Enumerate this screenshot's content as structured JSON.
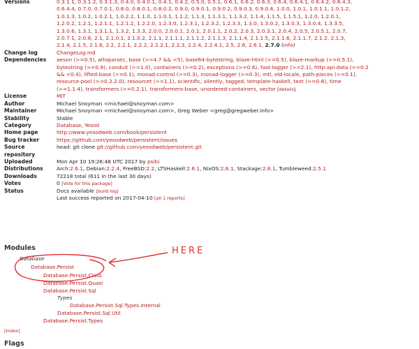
{
  "properties": {
    "versions_label": "Versions",
    "versions_lines": [
      "0.3.1.1, 0.3.1.2, 0.3.1.3, 0.4.0, 0.4.0.1, 0.4.1, 0.4.2, 0.5.0, 0.5.1, 0.6.1, 0.6.2, 0.6.3, 0.6.4, 0.6.4.1, 0.6.4.2, 0.6.4.3,",
      "0.6.4.4, 0.7.0, 0.7.0.1, 0.8.0, 0.8.0.1, 0.8.0.2, 0.9.0, 0.9.0.1, 0.9.0.2, 0.9.0.3, 0.9.0.4, 1.0.0, 1.0.1, 1.0.1.1, 1.0.1.2,",
      "1.0.1.3, 1.0.2, 1.0.2.1, 1.0.2.2, 1.1.0, 1.1.0.1, 1.1.2, 1.1.3, 1.1.3.1, 1.1.3.2, 1.1.4, 1.1.5, 1.1.5.1, 1.2.0, 1.2.0.1,",
      "1.2.0.2, 1.2.1, 1.2.1.1, 1.2.1.2, 1.2.2.0, 1.2.3.0, 1.2.3.1, 1.2.3.2, 1.2.3.3, 1.3.0, 1.3.0.2, 1.3.0.3, 1.3.0.4, 1.3.3.5,",
      "1.3.0.6, 1.3.1, 1.3.1.1, 1.3.2, 1.3.3, 2.0.0, 2.0.0.1, 2.0.1, 2.0.1.1, 2.0.2, 2.0.3, 2.0.3.1, 2.0.4, 2.0.5, 2.0.5.1, 2.0.7,",
      "2.0.7.1, 2.0.8, 2.1, 2.1.0.1, 2.1.0.2, 2.1.1, 2.1.1.1, 2.1.1.2, 2.1.1.3, 2.1.1.4, 2.1.1.5, 2.1.1.6, 2.1.1.7, 2.1.2, 2.1.3,",
      "2.1.4, 2.1.5, 2.1.6, 2.2, 2.2.1, 2.2.2, 2.2.2.1, 2.2.3, 2.2.4, 2.2.4.1, 2.5, 2.6, 2.6.1,"
    ],
    "versions_current": "2.7.0",
    "versions_info": "info",
    "changelog_label": "Change log",
    "changelog_value": "ChangeLog.md",
    "dependencies_label": "Dependencies",
    "dependencies_lines": [
      "aeson (>=0.5), attoparsec, base (>=4.7 && <5), base64-bytestring, blaze-html (>=0.5), blaze-markup (>=0.5.1),",
      "bytestring (>=0.9), conduit (>=1.0), containers (>=0.2), exceptions (>=0.6), fast-logger (>=2.1), http-api-data (>=0.2",
      "&& <0.4), lifted-base (>=0.1), monad-control (>=0.3), monad-logger (>=0.3), mtl, old-locale, path-pieces (>=0.1),",
      "resource-pool (>=0.2.2.0), resourcet (>=1.1), scientific, silently, tagged, template-haskell, text (>=0.8), time",
      "(>=1.1.4), transformers (>=0.2.1), transformers-base, unordered-containers, vector"
    ],
    "dependencies_details": "details",
    "license_label": "License",
    "license_value": "MIT",
    "author_label": "Author",
    "author_value": "Michael Snoyman <michael@snoyman.com>",
    "maintainer_label": "Maintainer",
    "maintainer_value": "Michael Snoyman <michael@snoyman.com>, Greg Weber <greg@gregweber.info>",
    "stability_label": "Stability",
    "stability_value": "Stable",
    "category_label": "Category",
    "category_value": "Database, Yesod",
    "homepage_label": "Home page",
    "homepage_value": "http://www.yesodweb.com/book/persistent",
    "bugtracker_label": "Bug tracker",
    "bugtracker_value": "https://github.com/yesodweb/persistent/issues",
    "source_label": "Source repository",
    "source_prefix": "head: git clone",
    "source_value": "git://github.com/yesodweb/persistent.git",
    "uploaded_label": "Uploaded",
    "uploaded_value": "Mon Apr 10 19:26:48 UTC 2017 by",
    "uploaded_by": "psibi",
    "distributions_label": "Distributions",
    "distributions_parts": [
      {
        "name": "Arch:",
        "ver": "2.6.1"
      },
      {
        "name": ", Debian:",
        "ver": "2.2.4"
      },
      {
        "name": ", FreeBSD:",
        "ver": "2.2"
      },
      {
        "name": ", LTSHaskell:",
        "ver": "2.6.1"
      },
      {
        "name": ", NixOS:",
        "ver": "2.6.1"
      },
      {
        "name": ", Stackage:",
        "ver": "2.6.1"
      },
      {
        "name": ", Tumbleweed:",
        "ver": "2.5.1"
      }
    ],
    "downloads_label": "Downloads",
    "downloads_value": "72218 total (611 in the last 30 days)",
    "votes_label": "Votes",
    "votes_value": "0",
    "votes_link": "[Vote for this package]",
    "status_label": "Status",
    "status_line1": "Docs available",
    "status_buildlog": "[build log]",
    "status_line2": "Last success reported on 2017-04-10",
    "status_allreports": "[all 1 reports]"
  },
  "modules": {
    "heading": "Modules",
    "group_database": "Database",
    "items": [
      "Database.Persist",
      "Database.Persist.Class",
      "Database.Persist.Quasi",
      "Database.Persist.Sql"
    ],
    "group_types": "Types",
    "sql_types_internal": "Database.Persist.Sql.Types.Internal",
    "sql_util": "Database.Persist.Sql.Util",
    "types": "Database.Persist.Types",
    "index_link": "[Index]"
  },
  "flags": {
    "heading": "Flags"
  },
  "annotation": {
    "text": "HERE",
    "color": "#e03030"
  }
}
